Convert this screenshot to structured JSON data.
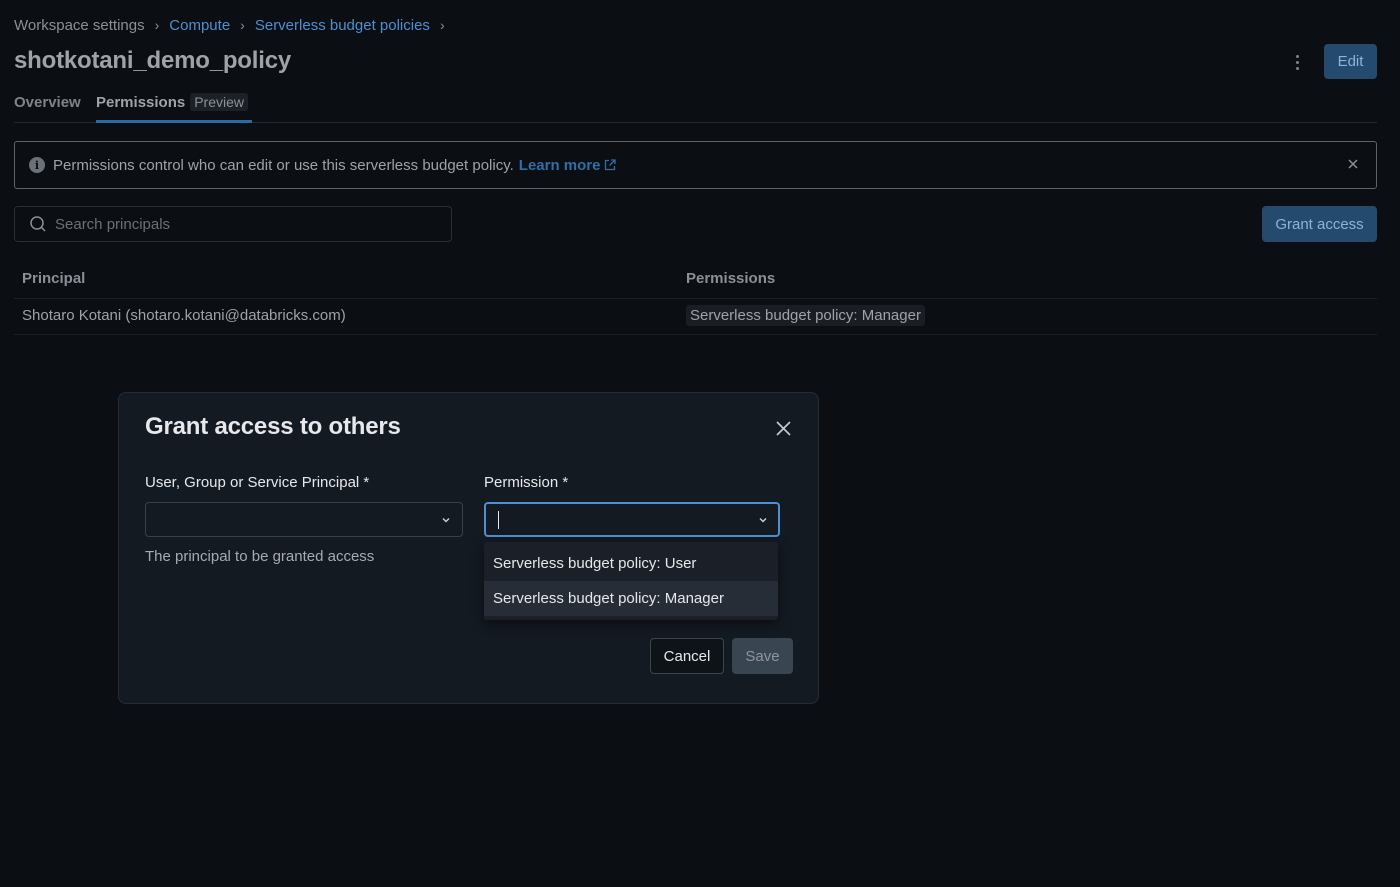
{
  "breadcrumb": {
    "items": [
      "Workspace settings",
      "Compute",
      "Serverless budget policies"
    ],
    "separator": "›"
  },
  "page": {
    "title": "shotkotani_demo_policy",
    "edit_label": "Edit"
  },
  "tabs": {
    "overview": "Overview",
    "permissions": "Permissions",
    "permissions_badge": "Preview",
    "active": "permissions"
  },
  "alert": {
    "icon": "i",
    "text": "Permissions control who can edit or use this serverless budget policy.",
    "link": "Learn more"
  },
  "search": {
    "placeholder": "Search principals",
    "value": ""
  },
  "grant_access_label": "Grant access",
  "table": {
    "columns": [
      "Principal",
      "Permissions"
    ],
    "rows": [
      {
        "principal": "Shotaro Kotani (shotaro.kotani@databricks.com)",
        "permission": "Serverless budget policy: Manager"
      }
    ]
  },
  "modal": {
    "title": "Grant access to others",
    "principal_label": "User, Group or Service Principal *",
    "principal_value": "",
    "principal_help": "The principal to be granted access",
    "permission_label": "Permission *",
    "permission_value": "",
    "permission_options": [
      "Serverless budget policy: User",
      "Serverless budget policy: Manager"
    ],
    "highlighted_option": "Serverless budget policy: Manager",
    "cancel_label": "Cancel",
    "save_label": "Save"
  },
  "colors": {
    "background": "#0b0e12",
    "primary": "#244a6e",
    "link": "#4d8fcf",
    "modal_bg": "#141a22",
    "focus": "#4d8fcf"
  }
}
